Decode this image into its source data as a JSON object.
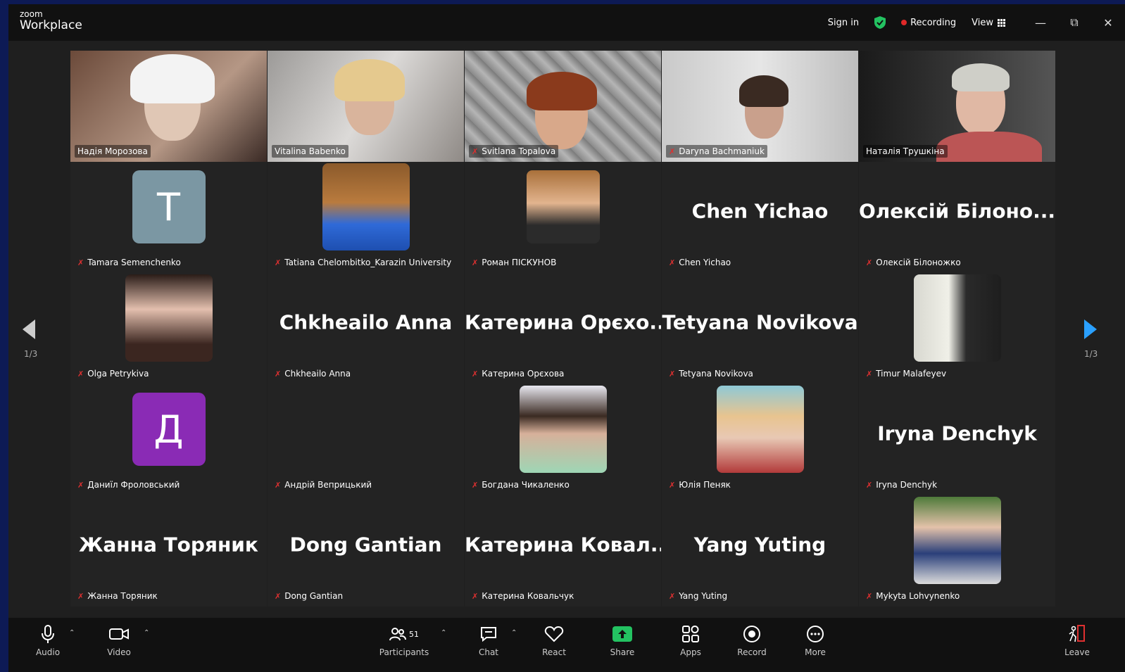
{
  "app": {
    "logo_top": "zoom",
    "logo_bottom": "Workplace"
  },
  "titlebar": {
    "sign_in": "Sign in",
    "recording": "Recording",
    "view": "View"
  },
  "colors": {
    "accent_green": "#23d36c",
    "share_green": "#23c261",
    "mic_off_red": "#e03030",
    "arrow_blue": "#2aa0ff"
  },
  "gallery": {
    "page_indicator_left": "1/3",
    "page_indicator_right": "1/3",
    "tiles": [
      {
        "name": "Надія Морозова",
        "type": "video",
        "muted": false
      },
      {
        "name": "Vitalina Babenko",
        "type": "video",
        "muted": false
      },
      {
        "name": "Svitlana Topalova",
        "type": "video",
        "muted": true
      },
      {
        "name": "Daryna Bachmaniuk",
        "type": "video",
        "muted": true
      },
      {
        "name": "Наталія Трушкіна",
        "type": "video",
        "muted": false,
        "active": true
      },
      {
        "name": "Tamara Semenchenko",
        "type": "letter",
        "letter": "T",
        "color": "#7b97a3",
        "muted": true
      },
      {
        "name": "Tatiana Chelombitko_Karazin University",
        "type": "photo",
        "muted": true
      },
      {
        "name": "Роман ПІСКУНОВ",
        "type": "photo",
        "muted": true
      },
      {
        "name": "Chen Yichao",
        "type": "text",
        "display": "Chen Yichao",
        "muted": true
      },
      {
        "name": "Олексій Білоножко",
        "type": "text",
        "display": "Олексій Білоно...",
        "muted": true
      },
      {
        "name": "Olga Petrykiva",
        "type": "photo",
        "muted": true
      },
      {
        "name": "Chkheailo Anna",
        "type": "text",
        "display": "Chkheailo Anna",
        "muted": true
      },
      {
        "name": "Катерина Орєхова",
        "type": "text",
        "display": "Катерина Орєхо...",
        "muted": true
      },
      {
        "name": "Tetyana Novikova",
        "type": "text",
        "display": "Tetyana Novikova",
        "muted": true
      },
      {
        "name": "Timur Malafeyev",
        "type": "photo",
        "muted": true
      },
      {
        "name": "Даниїл Фроловський",
        "type": "letter",
        "letter": "Д",
        "color": "#8a2bb5",
        "muted": true
      },
      {
        "name": "Андрій Веприцький",
        "type": "blank",
        "muted": true
      },
      {
        "name": "Богдана Чикаленко",
        "type": "photo",
        "muted": true
      },
      {
        "name": "Юлія Пеняк",
        "type": "photo",
        "muted": true
      },
      {
        "name": "Iryna Denchyk",
        "type": "text",
        "display": "Iryna Denchyk",
        "muted": true
      },
      {
        "name": "Жанна Торяник",
        "type": "text",
        "display": "Жанна Торяник",
        "muted": true
      },
      {
        "name": "Dong Gantian",
        "type": "text",
        "display": "Dong Gantian",
        "muted": true
      },
      {
        "name": "Катерина Ковальчук",
        "type": "text",
        "display": "Катерина Ковал...",
        "muted": true
      },
      {
        "name": "Yang Yuting",
        "type": "text",
        "display": "Yang Yuting",
        "muted": true
      },
      {
        "name": "Mykyta Lohvynenko",
        "type": "photo",
        "muted": true
      }
    ]
  },
  "toolbar": {
    "audio": "Audio",
    "video": "Video",
    "participants": "Participants",
    "participants_count": "51",
    "chat": "Chat",
    "react": "React",
    "share": "Share",
    "apps": "Apps",
    "record": "Record",
    "more": "More",
    "leave": "Leave"
  }
}
